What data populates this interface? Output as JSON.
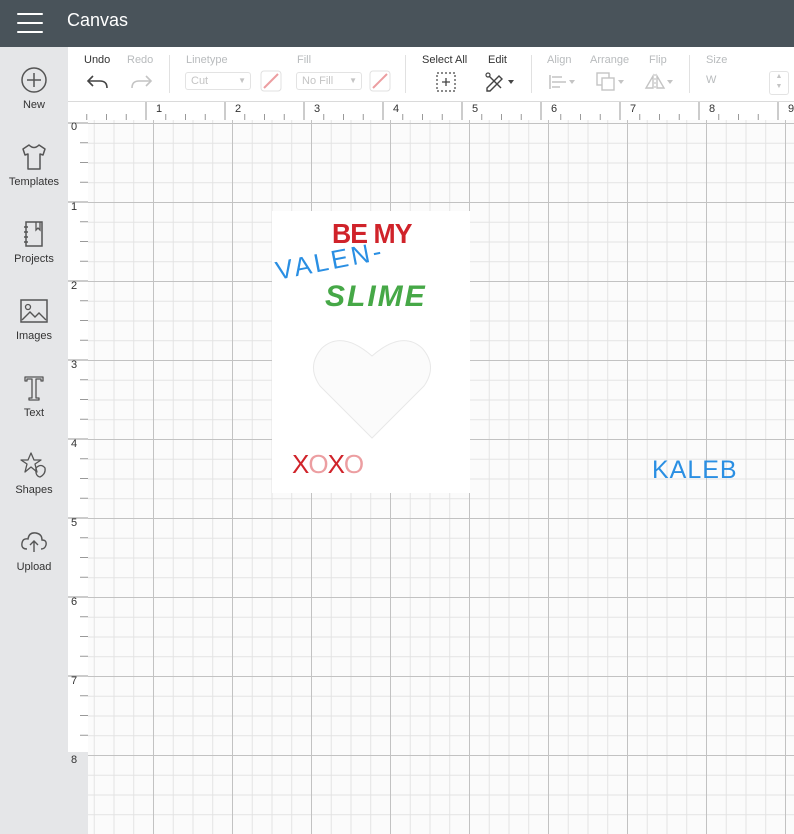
{
  "app": {
    "title": "Canvas"
  },
  "sidebar": {
    "items": [
      {
        "label": "New",
        "icon": "plus-circle-icon"
      },
      {
        "label": "Templates",
        "icon": "tshirt-icon"
      },
      {
        "label": "Projects",
        "icon": "notebook-icon"
      },
      {
        "label": "Images",
        "icon": "image-icon"
      },
      {
        "label": "Text",
        "icon": "text-icon"
      },
      {
        "label": "Shapes",
        "icon": "shapes-icon"
      },
      {
        "label": "Upload",
        "icon": "cloud-upload-icon"
      }
    ]
  },
  "toolbar": {
    "undo_label": "Undo",
    "redo_label": "Redo",
    "linetype_label": "Linetype",
    "linetype_value": "Cut",
    "fill_label": "Fill",
    "fill_value": "No Fill",
    "select_all_label": "Select All",
    "edit_label": "Edit",
    "align_label": "Align",
    "arrange_label": "Arrange",
    "flip_label": "Flip",
    "size_label": "Size",
    "size_w_label": "W"
  },
  "ruler": {
    "top": [
      "1",
      "2",
      "3",
      "4",
      "5",
      "6",
      "7",
      "8",
      "9"
    ],
    "left": [
      "0",
      "1",
      "2",
      "3",
      "4",
      "5",
      "6",
      "7",
      "8"
    ]
  },
  "design": {
    "line1": "BE MY",
    "line2": "VALEN-",
    "line3": "SLIME",
    "xoxo": [
      "X",
      "O",
      "X",
      "O"
    ],
    "name": "KALEB"
  },
  "colors": {
    "topbar": "#49535a",
    "red": "#d0232a",
    "blue": "#2a8fe3",
    "green": "#46a847",
    "pink": "#ec9ea1"
  }
}
